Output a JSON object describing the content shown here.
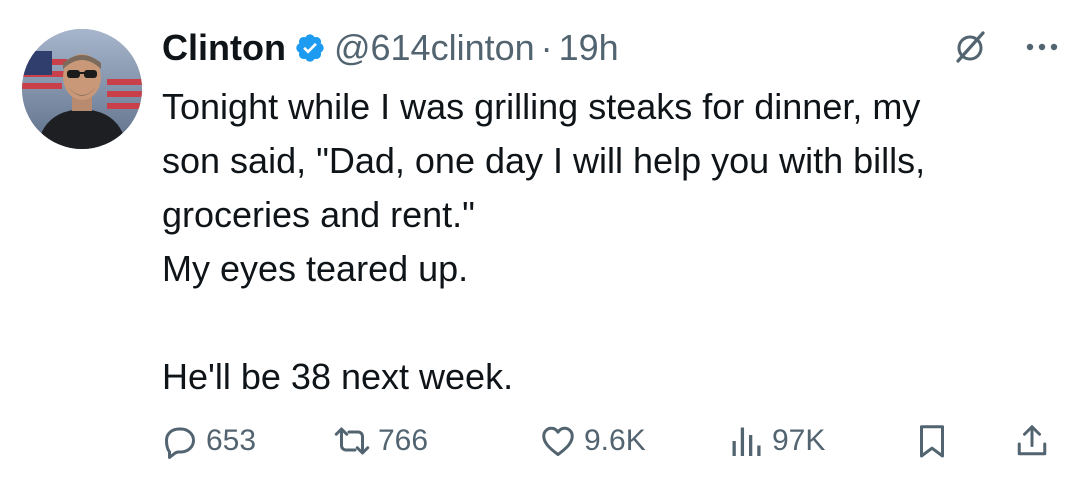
{
  "author": {
    "name": "Clinton",
    "handle": "@614clinton",
    "separator": "·",
    "time": "19h"
  },
  "body": "Tonight while I was grilling steaks for dinner, my\nson said, \"Dad, one day I will help you with bills,\ngroceries and rent.\"\nMy eyes teared up.\n\nHe'll be 38 next week.",
  "stats": {
    "replies": "653",
    "reposts": "766",
    "likes": "9.6K",
    "views": "97K"
  },
  "icons": {
    "verified": "verified-badge-icon",
    "grok": "grok-icon",
    "more": "more-dots-icon",
    "reply": "reply-icon",
    "repost": "repost-icon",
    "like": "heart-icon",
    "views": "views-chart-icon",
    "bookmark": "bookmark-icon",
    "share": "share-icon"
  },
  "colors": {
    "text": "#0f1419",
    "secondary": "#536471",
    "verified": "#1d9bf0"
  }
}
